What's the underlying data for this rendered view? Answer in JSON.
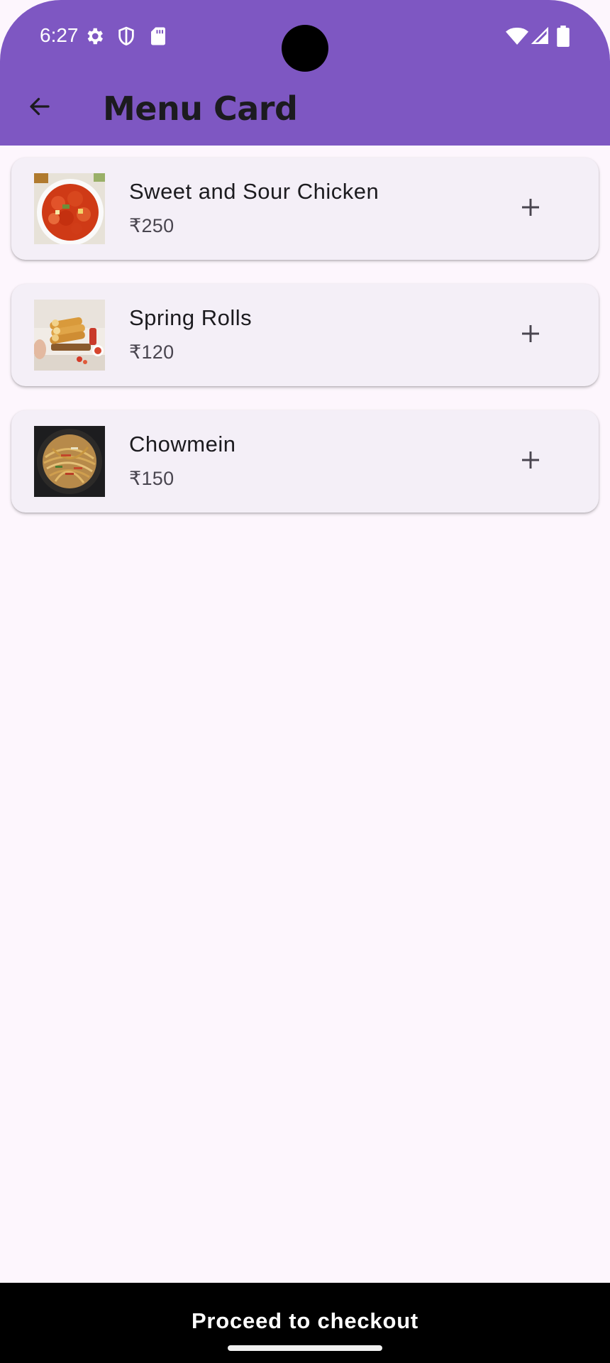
{
  "status_bar": {
    "time": "6:27",
    "icons": [
      "settings-icon",
      "shield-icon",
      "sd-card-icon",
      "wifi-icon",
      "signal-icon",
      "battery-icon"
    ]
  },
  "app_bar": {
    "title": "Menu Card",
    "back_icon": "arrow-back-icon",
    "color": "#7e57c2"
  },
  "menu": {
    "items": [
      {
        "name": "Sweet and Sour Chicken",
        "price": "₹250",
        "image": "sweet-sour-chicken-photo",
        "action_icon": "add-icon"
      },
      {
        "name": "Spring Rolls",
        "price": "₹120",
        "image": "spring-rolls-photo",
        "action_icon": "add-icon"
      },
      {
        "name": "Chowmein",
        "price": "₹150",
        "image": "chowmein-photo",
        "action_icon": "add-icon"
      }
    ]
  },
  "footer": {
    "checkout_label": "Proceed to checkout"
  }
}
